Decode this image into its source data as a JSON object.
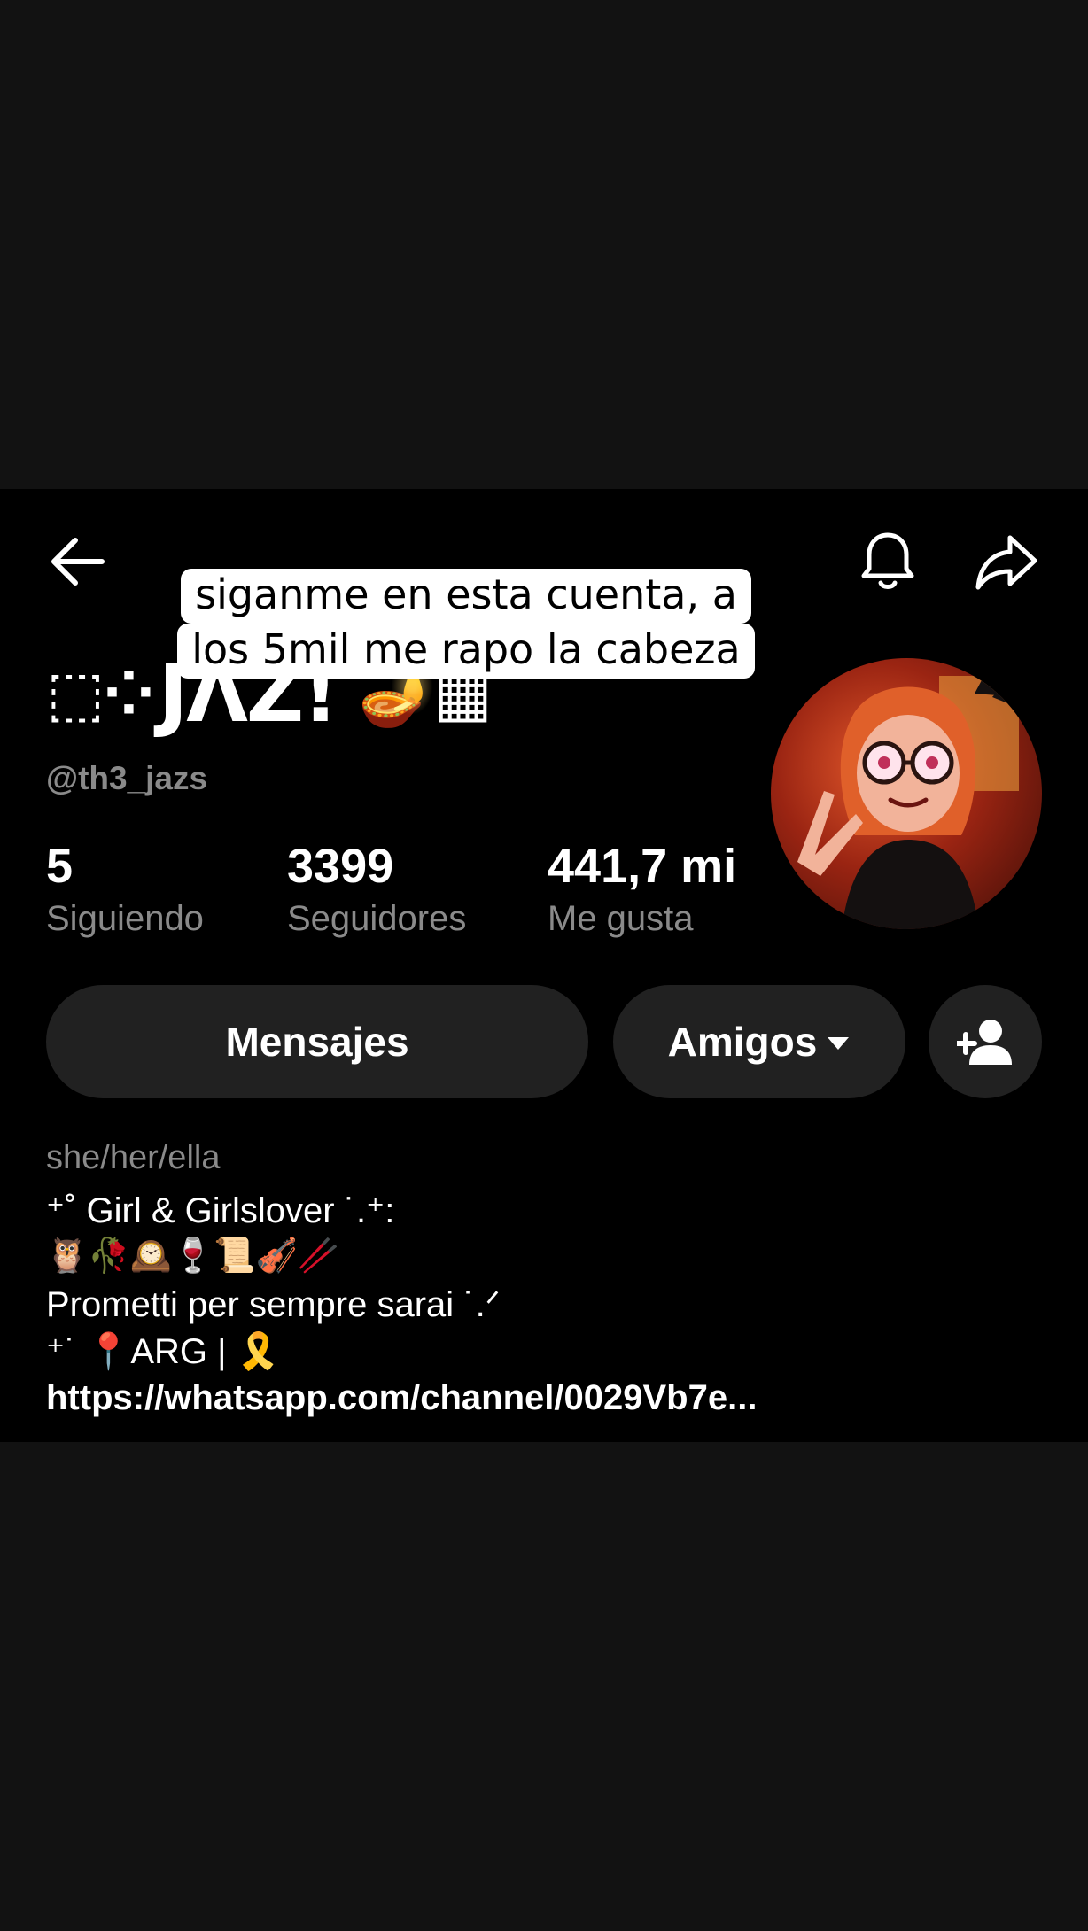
{
  "overlay": {
    "caption_line1": "siganme en esta cuenta, a",
    "caption_line2": "los 5mil me rapo la cabeza"
  },
  "header": {
    "back_icon": "back-arrow-icon",
    "bell_icon": "bell-icon",
    "share_icon": "share-icon"
  },
  "profile": {
    "display_name_deco_left": "⬚⁘",
    "display_name": "JΛZ!",
    "display_name_deco_right": "🪔▦",
    "handle": "@th3_jazs",
    "avatar_icon": "avatar-illustration"
  },
  "stats": {
    "following_count": "5",
    "following_label": "Siguiendo",
    "followers_count": "3399",
    "followers_label": "Seguidores",
    "likes_count": "441,7 mi",
    "likes_label": "Me gusta"
  },
  "actions": {
    "messages_label": "Mensajes",
    "friends_label": "Amigos",
    "add_friend_icon": "add-user-icon"
  },
  "bio": {
    "pronouns": "she/her/ella",
    "line1": "⁺˚ Girl & Girlslover ˙.⁺:",
    "line2": "🦉🥀🕰️🍷📜🎻🥢",
    "line3": "Prometti per sempre sarai ˙.ᐟ",
    "line4": "⁺˙ 📍ARG | 🎗️",
    "link": "https://whatsapp.com/channel/0029Vb7e..."
  },
  "colors": {
    "background": "#000000",
    "letterbox": "#121212",
    "button_bg": "#212121",
    "secondary_text": "#8a8a8a"
  }
}
